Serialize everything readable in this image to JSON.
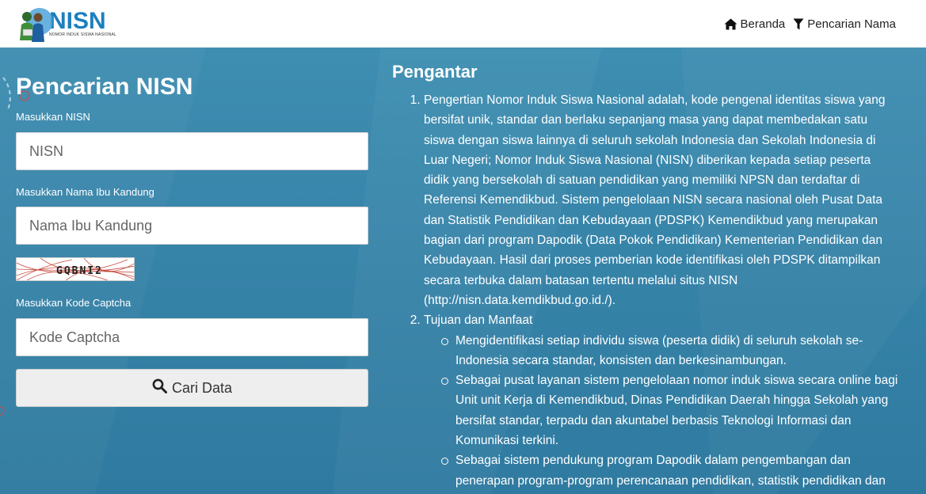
{
  "navbar": {
    "logo_title": "NISN",
    "logo_subtitle": "NOMOR INDUK SISWA NASIONAL",
    "links": [
      {
        "label": "Beranda",
        "icon": "home-icon"
      },
      {
        "label": "Pencarian Nama",
        "icon": "filter-icon"
      }
    ]
  },
  "search": {
    "title": "Pencarian NISN",
    "nisn_label": "Masukkan NISN",
    "nisn_placeholder": "NISN",
    "mother_label": "Masukkan Nama Ibu Kandung",
    "mother_placeholder": "Nama Ibu Kandung",
    "captcha_text": "GQBNI2",
    "captcha_label": "Masukkan Kode Captcha",
    "captcha_placeholder": "Kode Captcha",
    "button_label": "Cari Data",
    "button_icon": "search-icon"
  },
  "intro": {
    "title": "Pengantar",
    "item1": "Pengertian Nomor Induk Siswa Nasional adalah, kode pengenal identitas siswa yang bersifat unik, standar dan berlaku sepanjang masa yang dapat membedakan satu siswa dengan siswa lainnya di seluruh sekolah Indonesia dan Sekolah Indonesia di Luar Negeri; Nomor Induk Siswa Nasional (NISN) diberikan kepada setiap peserta didik yang bersekolah di satuan pendidikan yang memiliki NPSN dan terdaftar di Referensi Kemendikbud. Sistem pengelolaan NISN secara nasional oleh Pusat Data dan Statistik Pendidikan dan Kebudayaan (PDSPK) Kemendikbud yang merupakan bagian dari program Dapodik (Data Pokok Pendidikan) Kementerian Pendidikan dan Kebudayaan. Hasil dari proses pemberian kode identifikasi oleh PDSPK ditampilkan secara terbuka dalam batasan tertentu melalui situs NISN (http://nisn.data.kemdikbud.go.id./).",
    "item2": "Tujuan dan Manfaat",
    "sub1": "Mengidentifikasi setiap individu siswa (peserta didik) di seluruh sekolah se-Indonesia secara standar, konsisten dan berkesinambungan.",
    "sub2": "Sebagai pusat layanan sistem pengelolaan nomor induk siswa secara online bagi Unit unit Kerja di Kemendikbud, Dinas Pendidikan Daerah hingga Sekolah yang bersifat standar, terpadu dan akuntabel berbasis Teknologi Informasi dan Komunikasi terkini.",
    "sub3": "Sebagai sistem pendukung program Dapodik dalam pengembangan dan penerapan program-program perencanaan pendidikan, statistik pendidikan dan program pendidikan lainnya baik di tingkat pusat, propinsi, kota, kabupaten"
  }
}
